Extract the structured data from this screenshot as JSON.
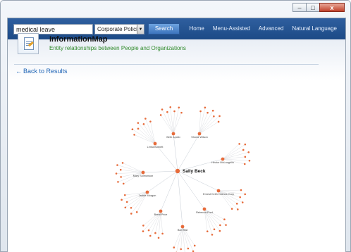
{
  "search": {
    "value": "medical leave",
    "button_label": "Search"
  },
  "scope_select": {
    "selected": "Corporate Policies"
  },
  "nav": {
    "items": [
      "Home",
      "Menu-Assisted",
      "Advanced",
      "Natural Language"
    ]
  },
  "header": {
    "title": "InformationMap",
    "subtitle": "Entity relationships between People and Organizations"
  },
  "back_link": {
    "label": "Back to Results"
  },
  "graph": {
    "center": "Sally Beck",
    "primary_nodes": [
      "Beth Apollo",
      "Shona Wilson",
      "Lenta Burnett",
      "Hector McLaughlin",
      "Mary Solmonson",
      "Jackie Morgan",
      "Ernest Keith Holmes Corp",
      "Rebecca Ford",
      "Bob Hall",
      "Brent Price"
    ]
  }
}
